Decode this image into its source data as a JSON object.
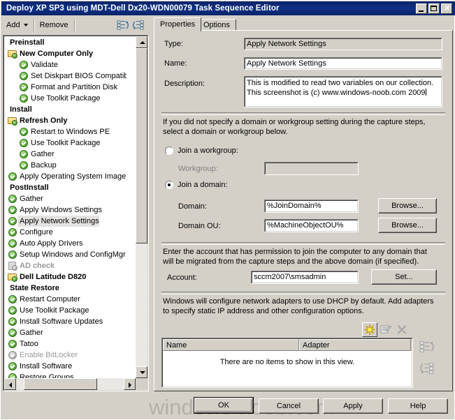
{
  "window": {
    "title": "Deploy XP SP3 using MDT-Dell Dx20-WDN00079 Task Sequence Editor",
    "minimize_icon": "minimize-icon",
    "maximize_icon": "maximize-icon",
    "close_icon": "close-icon",
    "close_glyph": "✕"
  },
  "toolbar": {
    "add_label": "Add",
    "remove_label": "Remove",
    "icon_move_up": "move-up-icon",
    "icon_move_down": "move-down-icon"
  },
  "tree": {
    "items": [
      {
        "label": "Preinstall",
        "level": 0,
        "icon": "none",
        "group": true,
        "disabled": false,
        "selected": false
      },
      {
        "label": "New Computer Only",
        "level": 1,
        "icon": "folder",
        "group": true,
        "disabled": false,
        "selected": false
      },
      {
        "label": "Validate",
        "level": 2,
        "icon": "check",
        "group": false,
        "disabled": false,
        "selected": false
      },
      {
        "label": "Set Diskpart BIOS Compatibi",
        "level": 2,
        "icon": "check",
        "group": false,
        "disabled": false,
        "selected": false
      },
      {
        "label": "Format and Partition Disk",
        "level": 2,
        "icon": "check",
        "group": false,
        "disabled": false,
        "selected": false
      },
      {
        "label": "Use Toolkit Package",
        "level": 2,
        "icon": "check",
        "group": false,
        "disabled": false,
        "selected": false
      },
      {
        "label": "Install",
        "level": 0,
        "icon": "none",
        "group": true,
        "disabled": false,
        "selected": false
      },
      {
        "label": "Refresh Only",
        "level": 1,
        "icon": "folder",
        "group": true,
        "disabled": false,
        "selected": false
      },
      {
        "label": "Restart to Windows PE",
        "level": 2,
        "icon": "check",
        "group": false,
        "disabled": false,
        "selected": false
      },
      {
        "label": "Use Toolkit Package",
        "level": 2,
        "icon": "check",
        "group": false,
        "disabled": false,
        "selected": false
      },
      {
        "label": "Gather",
        "level": 2,
        "icon": "check",
        "group": false,
        "disabled": false,
        "selected": false
      },
      {
        "label": "Backup",
        "level": 2,
        "icon": "check",
        "group": false,
        "disabled": false,
        "selected": false
      },
      {
        "label": "Apply Operating System Image",
        "level": 1,
        "icon": "check",
        "group": false,
        "disabled": false,
        "selected": false
      },
      {
        "label": "PostInstall",
        "level": 0,
        "icon": "none",
        "group": true,
        "disabled": false,
        "selected": false
      },
      {
        "label": "Gather",
        "level": 1,
        "icon": "check",
        "group": false,
        "disabled": false,
        "selected": false
      },
      {
        "label": "Apply Windows Settings",
        "level": 1,
        "icon": "check",
        "group": false,
        "disabled": false,
        "selected": false
      },
      {
        "label": "Apply Network Settings",
        "level": 1,
        "icon": "check",
        "group": false,
        "disabled": false,
        "selected": true
      },
      {
        "label": "Configure",
        "level": 1,
        "icon": "check",
        "group": false,
        "disabled": false,
        "selected": false
      },
      {
        "label": "Auto Apply Drivers",
        "level": 1,
        "icon": "check",
        "group": false,
        "disabled": false,
        "selected": false
      },
      {
        "label": "Setup Windows and ConfigMgr",
        "level": 1,
        "icon": "check",
        "group": false,
        "disabled": false,
        "selected": false
      },
      {
        "label": "AD check",
        "level": 1,
        "icon": "docdis",
        "group": true,
        "disabled": true,
        "selected": false
      },
      {
        "label": "Dell Latitude D820",
        "level": 1,
        "icon": "folder",
        "group": true,
        "disabled": false,
        "selected": false
      },
      {
        "label": "State Restore",
        "level": 0,
        "icon": "none",
        "group": true,
        "disabled": false,
        "selected": false
      },
      {
        "label": "Restart Computer",
        "level": 1,
        "icon": "check",
        "group": false,
        "disabled": false,
        "selected": false
      },
      {
        "label": "Use Toolkit Package",
        "level": 1,
        "icon": "check",
        "group": false,
        "disabled": false,
        "selected": false
      },
      {
        "label": "Install Software Updates",
        "level": 1,
        "icon": "check",
        "group": false,
        "disabled": false,
        "selected": false
      },
      {
        "label": "Gather",
        "level": 1,
        "icon": "check",
        "group": false,
        "disabled": false,
        "selected": false
      },
      {
        "label": "Tatoo",
        "level": 1,
        "icon": "check",
        "group": false,
        "disabled": false,
        "selected": false
      },
      {
        "label": "Enable BitLocker",
        "level": 1,
        "icon": "check",
        "group": false,
        "disabled": true,
        "selected": false
      },
      {
        "label": "Install Software",
        "level": 1,
        "icon": "check",
        "group": false,
        "disabled": false,
        "selected": false
      },
      {
        "label": "Restore Groups",
        "level": 1,
        "icon": "check",
        "group": false,
        "disabled": false,
        "selected": false
      }
    ]
  },
  "tabs": [
    {
      "label": "Properties",
      "active": true
    },
    {
      "label": "Options",
      "active": false
    }
  ],
  "properties": {
    "type_label": "Type:",
    "type_value": "Apply Network Settings",
    "name_label": "Name:",
    "name_value": "Apply Network Settings",
    "description_label": "Description:",
    "description_line1": "This is modified to read two variables on our collection.",
    "description_line2": "This screenshot is (c) www.windows-noob.com 2009",
    "intro_line1": "If you did not specify a domain or workgroup setting during the capture steps,",
    "intro_line2": "select a domain or workgroup below.",
    "join_workgroup_label": "Join a workgroup:",
    "join_workgroup_selected": false,
    "workgroup_label": "Workgroup:",
    "workgroup_value": "",
    "join_domain_label": "Join a domain:",
    "join_domain_selected": true,
    "domain_label": "Domain:",
    "domain_value": "%JoinDomain%",
    "domain_browse_label": "Browse...",
    "domain_ou_label": "Domain OU:",
    "domain_ou_value": "%MachineObjectOU%",
    "domain_ou_browse_label": "Browse...",
    "account_note_line1": "Enter the account that has permission to join the computer to any domain that",
    "account_note_line2": "will be migrated from the capture steps and the above domain (if specified).",
    "account_label": "Account:",
    "account_value": "sccm2007\\smsadmin",
    "account_set_label": "Set...",
    "adapter_note_line1": "Windows will configure network adapters to use DHCP by default. Add adapters",
    "adapter_note_line2": "to specify static IP address and other configuration options.",
    "adapter_new_icon": "new-adapter-icon",
    "adapter_edit_icon": "edit-adapter-icon",
    "adapter_delete_icon": "delete-adapter-icon",
    "adapter_moveup_icon": "move-up-icon",
    "adapter_movedown_icon": "move-down-icon",
    "list_columns": [
      "Name",
      "Adapter"
    ],
    "list_empty_text": "There are no items to show in this view."
  },
  "footer": {
    "ok_label": "OK",
    "cancel_label": "Cancel",
    "apply_label": "Apply",
    "help_label": "Help"
  },
  "watermark": {
    "text": "windows-noob.com"
  },
  "colors": {
    "titlebar": "#0a246a",
    "face": "#d4d0c8",
    "field": "#ffffff",
    "selection": "#e4e3e0",
    "watermark": "#b4b0a8"
  }
}
